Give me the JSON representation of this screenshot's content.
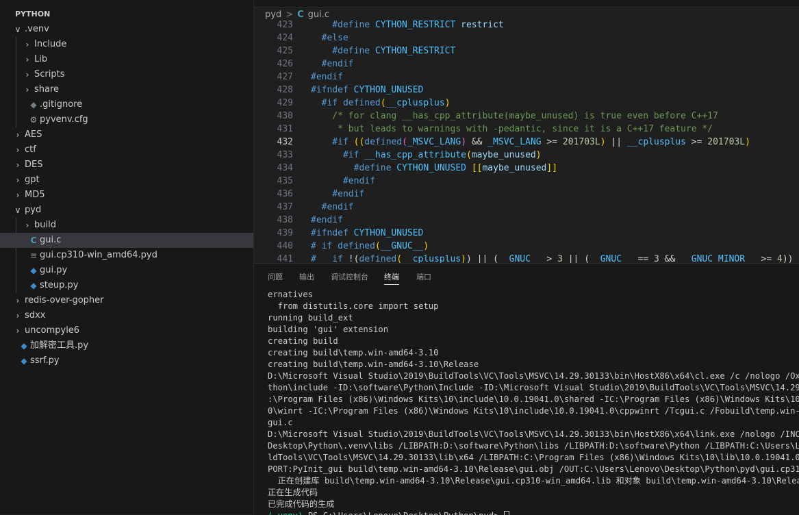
{
  "explorer": {
    "section_title": "PYTHON",
    "items": [
      {
        "label": ".venv",
        "kind": "folder",
        "expanded": true,
        "depth": 0
      },
      {
        "label": "Include",
        "kind": "folder",
        "expanded": false,
        "depth": 1
      },
      {
        "label": "Lib",
        "kind": "folder",
        "expanded": false,
        "depth": 1
      },
      {
        "label": "Scripts",
        "kind": "folder",
        "expanded": false,
        "depth": 1
      },
      {
        "label": "share",
        "kind": "folder",
        "expanded": false,
        "depth": 1
      },
      {
        "label": ".gitignore",
        "kind": "git",
        "depth": 1
      },
      {
        "label": "pyvenv.cfg",
        "kind": "gear",
        "depth": 1
      },
      {
        "label": "AES",
        "kind": "folder",
        "expanded": false,
        "depth": 0
      },
      {
        "label": "ctf",
        "kind": "folder",
        "expanded": false,
        "depth": 0
      },
      {
        "label": "DES",
        "kind": "folder",
        "expanded": false,
        "depth": 0
      },
      {
        "label": "gpt",
        "kind": "folder",
        "expanded": false,
        "depth": 0
      },
      {
        "label": "MD5",
        "kind": "folder",
        "expanded": false,
        "depth": 0
      },
      {
        "label": "pyd",
        "kind": "folder",
        "expanded": true,
        "depth": 0
      },
      {
        "label": "build",
        "kind": "folder",
        "expanded": false,
        "depth": 1
      },
      {
        "label": "gui.c",
        "kind": "c",
        "depth": 1,
        "selected": true
      },
      {
        "label": "gui.cp310-win_amd64.pyd",
        "kind": "file",
        "depth": 1
      },
      {
        "label": "gui.py",
        "kind": "py",
        "depth": 1
      },
      {
        "label": "steup.py",
        "kind": "py",
        "depth": 1
      },
      {
        "label": "redis-over-gopher",
        "kind": "folder",
        "expanded": false,
        "depth": 0
      },
      {
        "label": "sdxx",
        "kind": "folder",
        "expanded": false,
        "depth": 0
      },
      {
        "label": "uncompyle6",
        "kind": "folder",
        "expanded": false,
        "depth": 0
      },
      {
        "label": "加解密工具.py",
        "kind": "py",
        "depth": 0
      },
      {
        "label": "ssrf.py",
        "kind": "py",
        "depth": 0
      }
    ]
  },
  "breadcrumb": {
    "folder": "pyd",
    "separator": ">",
    "file": "gui.c",
    "file_icon": "C"
  },
  "editor": {
    "active_line": "432",
    "lines": [
      {
        "n": "423",
        "t": [
          [
            "p",
            "    #define "
          ],
          [
            "m",
            "CYTHON_RESTRICT"
          ],
          [
            "w",
            " restrict"
          ]
        ]
      },
      {
        "n": "424",
        "t": [
          [
            "p",
            "  #else"
          ]
        ]
      },
      {
        "n": "425",
        "t": [
          [
            "p",
            "    #define "
          ],
          [
            "m",
            "CYTHON_RESTRICT"
          ]
        ]
      },
      {
        "n": "426",
        "t": [
          [
            "p",
            "  #endif"
          ]
        ]
      },
      {
        "n": "427",
        "t": [
          [
            "p",
            "#endif"
          ]
        ]
      },
      {
        "n": "428",
        "t": [
          [
            "p",
            "#ifndef "
          ],
          [
            "m",
            "CYTHON_UNUSED"
          ]
        ]
      },
      {
        "n": "429",
        "t": [
          [
            "p",
            "  #if "
          ],
          [
            "p",
            "defined"
          ],
          [
            "y",
            "("
          ],
          [
            "m",
            "__cplusplus"
          ],
          [
            "y",
            ")"
          ]
        ]
      },
      {
        "n": "430",
        "t": [
          [
            "c",
            "    /* for clang __has_cpp_attribute(maybe_unused) is true even before C++17"
          ]
        ]
      },
      {
        "n": "431",
        "t": [
          [
            "c",
            "     * but leads to warnings with -pedantic, since it is a C++17 feature */"
          ]
        ]
      },
      {
        "n": "432",
        "t": [
          [
            "p",
            "    #if "
          ],
          [
            "y",
            "(("
          ],
          [
            "p",
            "defined"
          ],
          [
            "b",
            "("
          ],
          [
            "m",
            "_MSVC"
          ],
          [
            "m",
            "_LANG"
          ],
          [
            "b",
            ")"
          ],
          [
            "t",
            " && "
          ],
          [
            "m",
            "_MSVC_LANG"
          ],
          [
            "t",
            " >= "
          ],
          [
            "n",
            "201703L"
          ],
          [
            "y",
            ")"
          ],
          [
            "t",
            " || "
          ],
          [
            "m",
            "__cplusplus"
          ],
          [
            "t",
            " >= "
          ],
          [
            "n",
            "201703L"
          ],
          [
            "y",
            ")"
          ]
        ]
      },
      {
        "n": "433",
        "t": [
          [
            "p",
            "      #if "
          ],
          [
            "m",
            "__has_cpp_attribute"
          ],
          [
            "y",
            "("
          ],
          [
            "w",
            "maybe_unused"
          ],
          [
            "y",
            ")"
          ]
        ]
      },
      {
        "n": "434",
        "t": [
          [
            "p",
            "        #define "
          ],
          [
            "m",
            "CYTHON_UNUSED"
          ],
          [
            "t",
            " "
          ],
          [
            "y",
            "[["
          ],
          [
            "w",
            "maybe_unused"
          ],
          [
            "y",
            "]]"
          ]
        ]
      },
      {
        "n": "435",
        "t": [
          [
            "p",
            "      #endif"
          ]
        ]
      },
      {
        "n": "436",
        "t": [
          [
            "p",
            "    #endif"
          ]
        ]
      },
      {
        "n": "437",
        "t": [
          [
            "p",
            "  #endif"
          ]
        ]
      },
      {
        "n": "438",
        "t": [
          [
            "p",
            "#endif"
          ]
        ]
      },
      {
        "n": "439",
        "t": [
          [
            "p",
            "#ifndef "
          ],
          [
            "m",
            "CYTHON_UNUSED"
          ]
        ]
      },
      {
        "n": "440",
        "t": [
          [
            "p",
            "# if "
          ],
          [
            "p",
            "defined"
          ],
          [
            "y",
            "("
          ],
          [
            "m",
            "__GNUC__"
          ],
          [
            "y",
            ")"
          ]
        ]
      },
      {
        "n": "441",
        "t": [
          [
            "p",
            "#   if "
          ],
          [
            "t",
            "!("
          ],
          [
            "p",
            "defined"
          ],
          [
            "y",
            "("
          ],
          [
            "m",
            "__cplusplus"
          ],
          [
            "y",
            ")"
          ],
          [
            "t",
            ") || ("
          ],
          [
            "m",
            "__GNUC__"
          ],
          [
            "t",
            " > "
          ],
          [
            "n",
            "3"
          ],
          [
            "t",
            " || ("
          ],
          [
            "m",
            "__GNUC__"
          ],
          [
            "t",
            " == "
          ],
          [
            "n",
            "3"
          ],
          [
            "t",
            " && "
          ],
          [
            "m",
            "__GNUC_MINOR__"
          ],
          [
            "t",
            " >= "
          ],
          [
            "n",
            "4"
          ],
          [
            "t",
            "))"
          ]
        ]
      }
    ]
  },
  "panel": {
    "tabs": [
      "问题",
      "输出",
      "调试控制台",
      "终端",
      "端口"
    ],
    "active_tab": "终端",
    "terminal_lines": [
      "ernatives",
      "  from distutils.core import setup",
      "running build_ext",
      "building 'gui' extension",
      "creating build",
      "creating build\\temp.win-amd64-3.10",
      "creating build\\temp.win-amd64-3.10\\Release",
      "D:\\Microsoft Visual Studio\\2019\\BuildTools\\VC\\Tools\\MSVC\\14.29.30133\\bin\\HostX86\\x64\\cl.exe /c /nologo /Ox /W3",
      "thon\\include -ID:\\software\\Python\\Include -ID:\\Microsoft Visual Studio\\2019\\BuildTools\\VC\\Tools\\MSVC\\14.29.3013",
      ":\\Program Files (x86)\\Windows Kits\\10\\include\\10.0.19041.0\\shared -IC:\\Program Files (x86)\\Windows Kits\\10\\incl",
      "0\\winrt -IC:\\Program Files (x86)\\Windows Kits\\10\\include\\10.0.19041.0\\cppwinrt /Tcgui.c /Fobuild\\temp.win-amd64",
      "gui.c",
      "D:\\Microsoft Visual Studio\\2019\\BuildTools\\VC\\Tools\\MSVC\\14.29.30133\\bin\\HostX86\\x64\\link.exe /nologo /INCREMEN",
      "Desktop\\Python\\.venv\\libs /LIBPATH:D:\\software\\Python\\libs /LIBPATH:D:\\software\\Python /LIBPATH:C:\\Users\\Lenovo",
      "ldTools\\VC\\Tools\\MSVC\\14.29.30133\\lib\\x64 /LIBPATH:C:\\Program Files (x86)\\Windows Kits\\10\\lib\\10.0.19041.0\\ucrt",
      "PORT:PyInit_gui build\\temp.win-amd64-3.10\\Release\\gui.obj /OUT:C:\\Users\\Lenovo\\Desktop\\Python\\pyd\\gui.cp310-win",
      "  正在创建库 build\\temp.win-amd64-3.10\\Release\\gui.cp310-win_amd64.lib 和对象 build\\temp.win-amd64-3.10\\Release",
      "正在生成代码",
      "已完成代码的生成"
    ],
    "prompt_env": "(.venv)",
    "prompt_path": " PS C:\\Users\\Lenovo\\Desktop\\Python\\pyd> "
  },
  "colors": {
    "accent": "#0078d4",
    "selection": "#37373d",
    "preprocessor": "#569cd6",
    "macro": "#4fc1ff",
    "comment": "#6a9955",
    "number": "#b5cea8"
  }
}
